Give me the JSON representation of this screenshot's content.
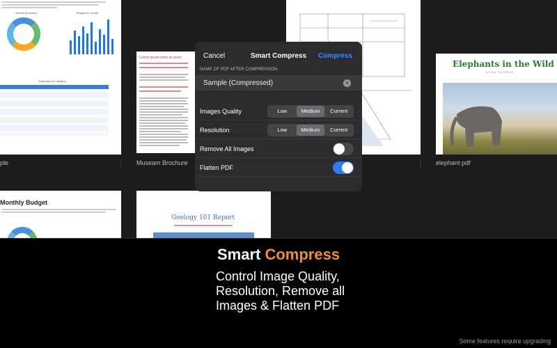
{
  "files": {
    "budget_label": "ple",
    "museum_label": "Museam Brochure",
    "elephant_label": "elephant pdf",
    "monthly_title": "Monthly Budget",
    "geology_title": "Geology 101 Report",
    "elephant_title": "Elephants in the Wild",
    "elephant_author": "DYNA SEMPER",
    "budget_chart_title": "Annual Summary",
    "budget_chart_title2": "Budget vs. Actual",
    "budget_table_title": "Summary by Category",
    "museum_heading": "Lorem ipsum dolor sit amet"
  },
  "dialog": {
    "cancel": "Cancel",
    "title": "Smart Compress",
    "compress": "Compress",
    "caption": "NAME OF PDF AFTER COMPRESSION",
    "filename": "Sample (Compressed)",
    "rows": {
      "images_quality": {
        "label": "Images Quality",
        "options": [
          "Low",
          "Medium",
          "Current"
        ],
        "selected": "Medium"
      },
      "resolution": {
        "label": "Resolution",
        "options": [
          "Low",
          "Medium",
          "Current"
        ],
        "selected": "Medium"
      },
      "remove_images": {
        "label": "Remove All Images",
        "on": false
      },
      "flatten": {
        "label": "Flatten PDF",
        "on": true
      }
    }
  },
  "promo": {
    "headline_a": "Smart",
    "headline_b": "Compress",
    "sub1": "Control Image Quality,",
    "sub2": "Resolution, Remove all",
    "sub3": "Images & Flatten PDF",
    "footnote": "Some features require upgrading"
  },
  "colors": {
    "accent_orange": "#f0902a",
    "accent_blue": "#3d8bff",
    "toggle_on": "#2f7cf6"
  }
}
